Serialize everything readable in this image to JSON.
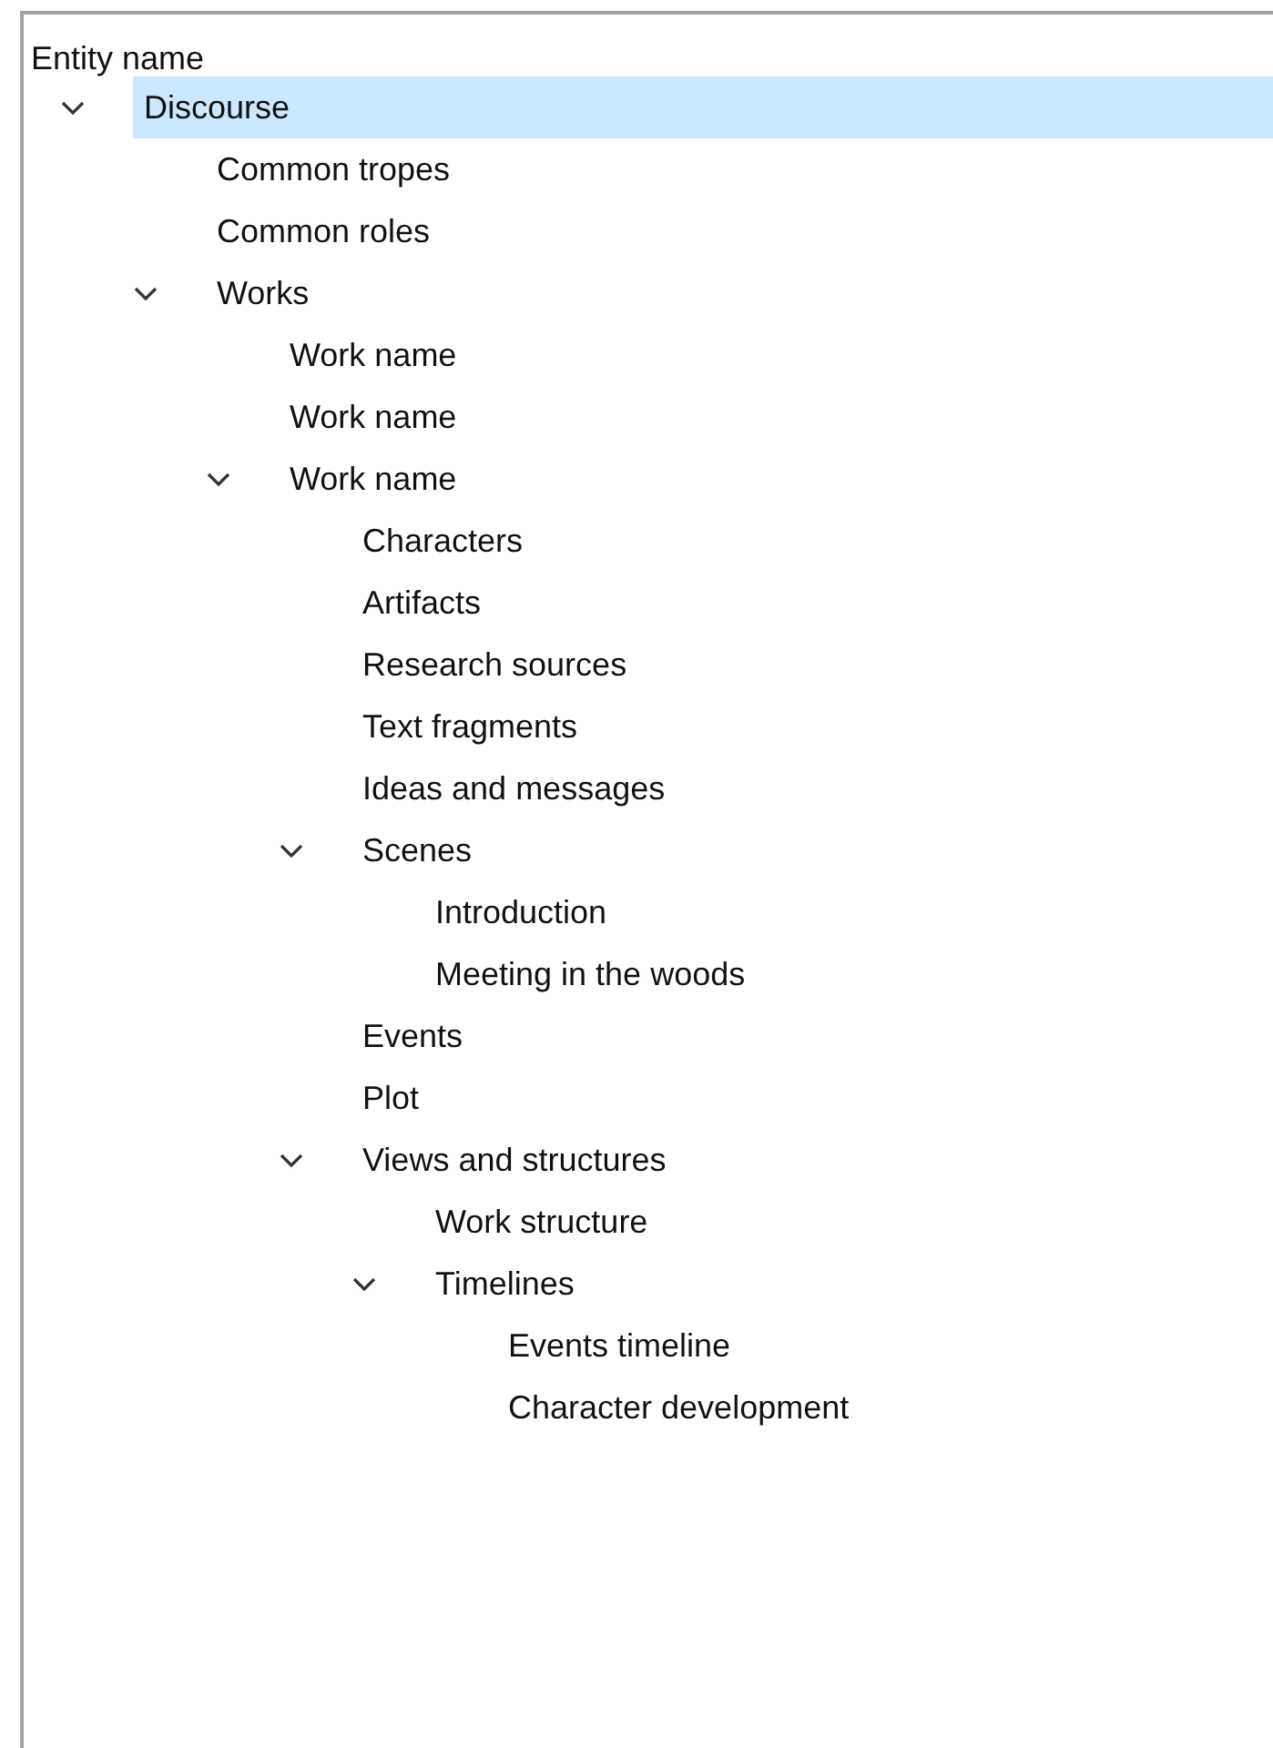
{
  "tree": {
    "column_header": "Entity name",
    "items": [
      {
        "label": "Discourse",
        "selected": true,
        "expanded": true,
        "children": [
          {
            "label": "Common tropes",
            "selected": false
          },
          {
            "label": "Common roles",
            "selected": false
          },
          {
            "label": "Works",
            "selected": false,
            "expanded": true,
            "children": [
              {
                "label": "Work name",
                "selected": false
              },
              {
                "label": "Work name",
                "selected": false
              },
              {
                "label": "Work name",
                "selected": false,
                "expanded": true,
                "children": [
                  {
                    "label": "Characters",
                    "selected": false
                  },
                  {
                    "label": "Artifacts",
                    "selected": false
                  },
                  {
                    "label": "Research sources",
                    "selected": false
                  },
                  {
                    "label": "Text fragments",
                    "selected": false
                  },
                  {
                    "label": "Ideas and messages",
                    "selected": false
                  },
                  {
                    "label": "Scenes",
                    "selected": false,
                    "expanded": true,
                    "children": [
                      {
                        "label": "Introduction",
                        "selected": false
                      },
                      {
                        "label": "Meeting in the woods",
                        "selected": false
                      }
                    ]
                  },
                  {
                    "label": "Events",
                    "selected": false
                  },
                  {
                    "label": "Plot",
                    "selected": false
                  },
                  {
                    "label": "Views and structures",
                    "selected": false,
                    "expanded": true,
                    "children": [
                      {
                        "label": "Work structure",
                        "selected": false
                      },
                      {
                        "label": "Timelines",
                        "selected": false,
                        "expanded": true,
                        "children": [
                          {
                            "label": "Events timeline",
                            "selected": false
                          },
                          {
                            "label": "Character development",
                            "selected": false
                          }
                        ]
                      }
                    ]
                  }
                ]
              }
            ]
          }
        ]
      }
    ]
  }
}
